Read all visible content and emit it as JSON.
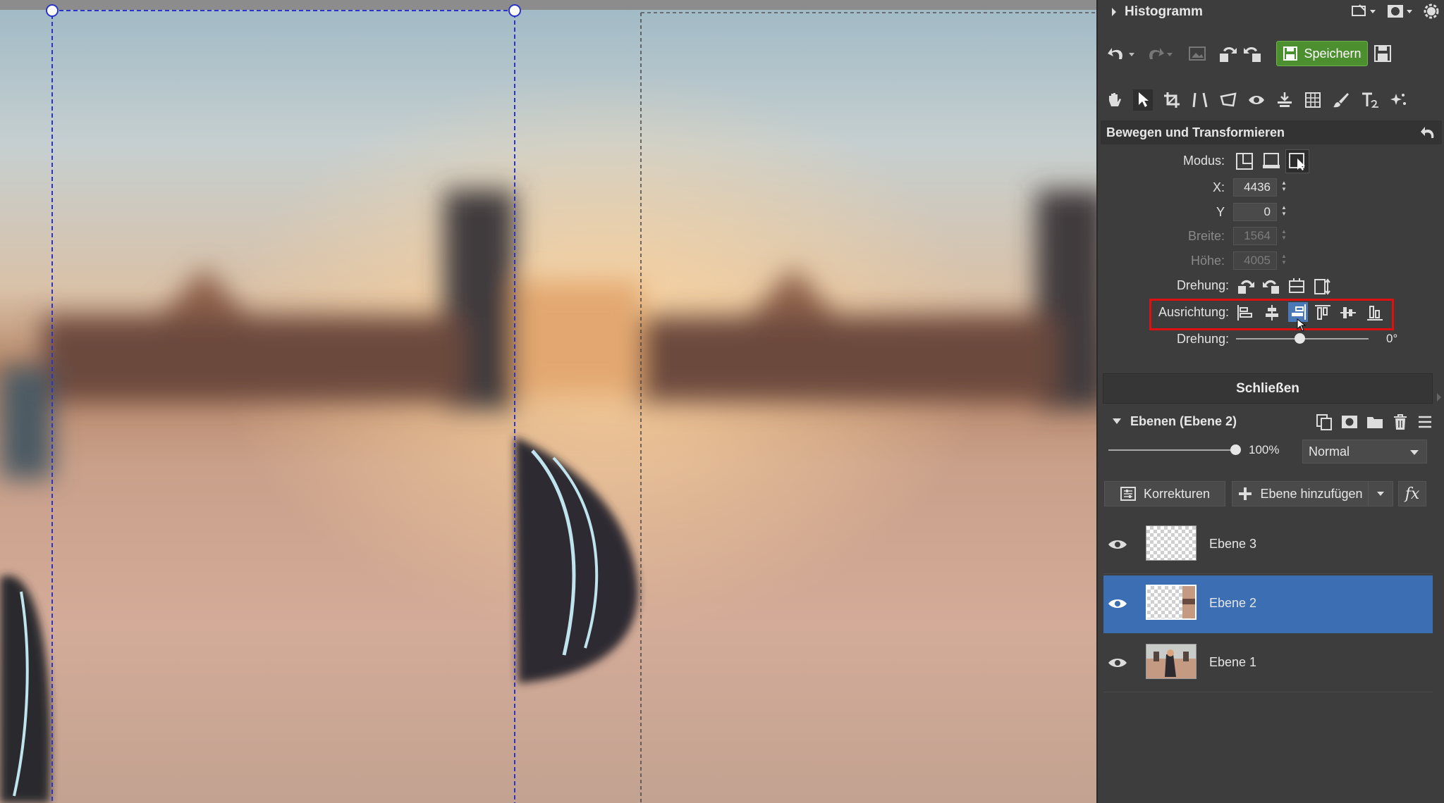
{
  "histogram": {
    "title": "Histogramm",
    "icons": [
      "chevron-right-icon",
      "crop-overlay-icon",
      "mask-icon",
      "gear-icon"
    ]
  },
  "toolbar": {
    "save_label": "Speichern",
    "icons": [
      "undo-icon",
      "redo-icon",
      "image-icon",
      "rotate-left-icon",
      "rotate-right-icon",
      "save-as-icon"
    ]
  },
  "tools": {
    "icons": [
      "hand-icon",
      "select-arrow-icon",
      "crop-icon",
      "straighten-icon",
      "perspective-icon",
      "eye-icon",
      "level-icon",
      "grid-icon",
      "brush-icon",
      "text-icon",
      "effects-icon"
    ]
  },
  "transform": {
    "title": "Bewegen und Transformieren",
    "mode_label": "Modus:",
    "x_label": "X:",
    "x_value": "4436",
    "y_label": "Y",
    "y_value": "0",
    "width_label": "Breite:",
    "width_value": "1564",
    "height_label": "Höhe:",
    "height_value": "4005",
    "rotate_label": "Drehung:",
    "align_label": "Ausrichtung:",
    "angle_label": "Drehung:",
    "angle_value": "0°",
    "angle_fraction": 0.5
  },
  "close_label": "Schließen",
  "layers": {
    "title": "Ebenen (Ebene 2)",
    "opacity": "100%",
    "blend_mode": "Normal",
    "corrections_label": "Korrekturen",
    "add_layer_label": "Ebene hinzufügen",
    "fx_label": "fx",
    "items": [
      {
        "name": "Ebene 3",
        "selected": false
      },
      {
        "name": "Ebene 2",
        "selected": true
      },
      {
        "name": "Ebene 1",
        "selected": false
      }
    ]
  },
  "colors": {
    "save_green": "#4b8f2e",
    "selected_blue": "#3c6eb3",
    "highlight_red": "#e01010",
    "selection_blue": "#2b34c8"
  }
}
